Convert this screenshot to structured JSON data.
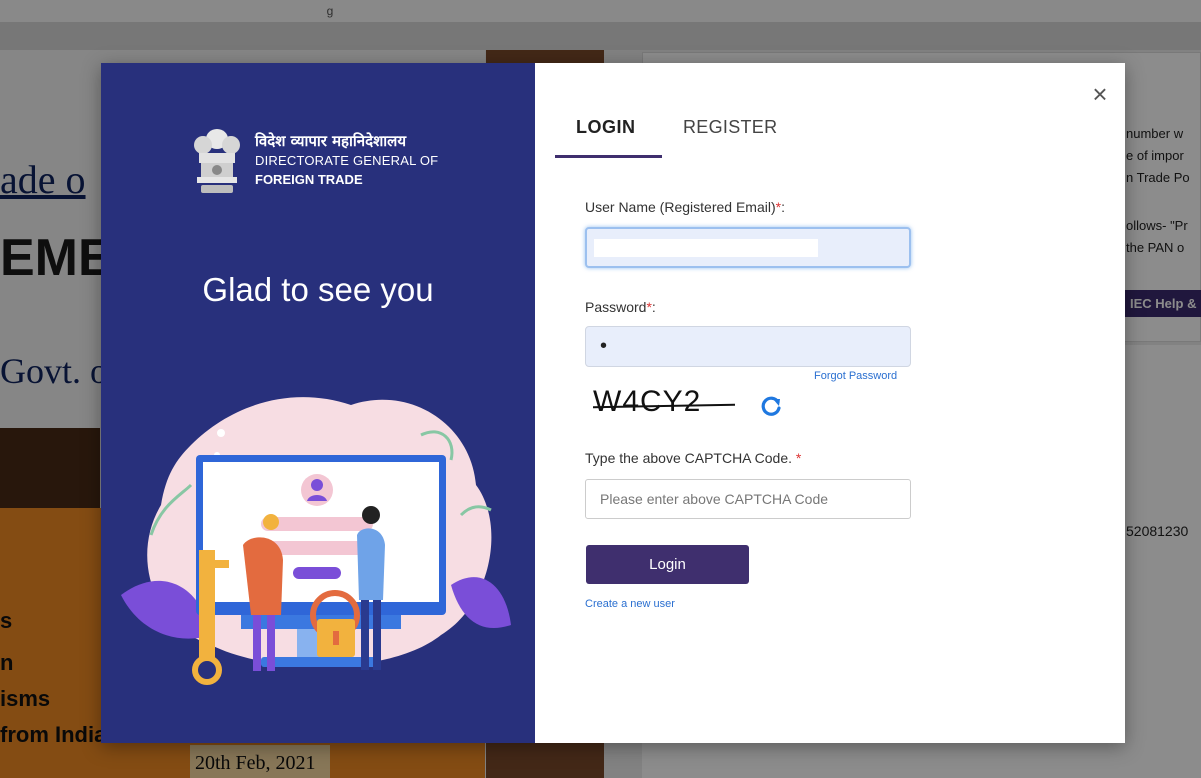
{
  "background_page": {
    "topbar_text": "g",
    "heading_1": "ade o",
    "heading_2": "EME",
    "heading_3": "Govt. o",
    "orange_lines": [
      "s",
      "n",
      "isms",
      "from India"
    ],
    "date": "20th Feb, 2021",
    "right_text": [
      "number w",
      "e of impor",
      "n Trade Po",
      "ollows- \"Pr",
      "the PAN o"
    ],
    "right_button": "IEC Help &",
    "right_number": "52081230"
  },
  "brand": {
    "hindi_name": "विदेश व्यापार महानिदेशालय",
    "line1": "DIRECTORATE GENERAL OF",
    "line2": "FOREIGN TRADE"
  },
  "greeting": "Glad to see you",
  "close_symbol": "×",
  "tabs": [
    {
      "label": "LOGIN",
      "active": true
    },
    {
      "label": "REGISTER",
      "active": false
    }
  ],
  "form": {
    "username_label": "User Name (Registered Email)",
    "username_value": "",
    "password_label": "Password",
    "password_value": "•",
    "forgot_password": "Forgot Password",
    "captcha_text": "W4CY2",
    "captcha_label": "Type the above CAPTCHA Code. ",
    "captcha_placeholder": "Please enter above CAPTCHA Code",
    "required_mark": "*",
    "login_button": "Login",
    "create_user": "Create a new user"
  },
  "icons": {
    "close": "close-icon",
    "refresh": "refresh-icon",
    "emblem": "national-emblem-icon"
  },
  "colors": {
    "left_panel": "#28307c",
    "primary_button": "#3f2f6e",
    "link": "#2a6fd0",
    "required": "#d33333"
  }
}
